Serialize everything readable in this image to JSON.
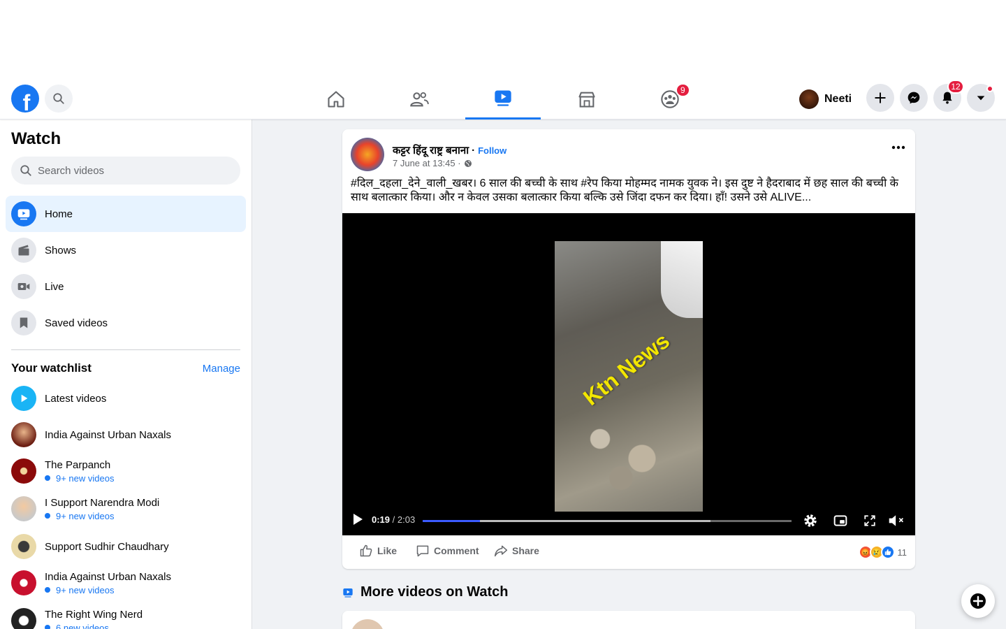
{
  "nav": {
    "groups_badge": "9",
    "profile_name": "Neeti",
    "notifications_badge": "12"
  },
  "sidebar": {
    "title": "Watch",
    "search_placeholder": "Search videos",
    "items": [
      {
        "label": "Home",
        "icon": "play-icon"
      },
      {
        "label": "Shows",
        "icon": "clapperboard-icon"
      },
      {
        "label": "Live",
        "icon": "live-camera-icon"
      },
      {
        "label": "Saved videos",
        "icon": "bookmark-icon"
      }
    ],
    "watchlist_title": "Your watchlist",
    "manage_label": "Manage",
    "watchlist": [
      {
        "name": "Latest videos",
        "sub": ""
      },
      {
        "name": "India Against Urban Naxals",
        "sub": ""
      },
      {
        "name": "The Parpanch",
        "sub": "9+ new videos"
      },
      {
        "name": "I Support Narendra Modi",
        "sub": "9+ new videos"
      },
      {
        "name": "Support Sudhir Chaudhary",
        "sub": ""
      },
      {
        "name": "India Against Urban Naxals",
        "sub": "9+ new videos"
      },
      {
        "name": "The Right Wing Nerd",
        "sub": "6 new videos"
      }
    ]
  },
  "post": {
    "author": "कट्टर हिंदू राष्ट्र बनाना",
    "separator": "·",
    "follow": "Follow",
    "timestamp": "7 June at 13:45 ·",
    "text": "#दिल_दहला_देने_वाली_खबर। 6 साल की बच्ची के साथ #रेप किया मोहम्मद नामक युवक ने। इस दुष्ट ने हैदराबाद में छह साल की बच्ची के साथ बलात्कार किया। और न केवल उसका बलात्कार किया बल्कि उसे जिंदा दफन कर दिया। हाँ! उसने उसे ALIVE...",
    "video": {
      "watermark": "Ktn News",
      "current_time": "0:19",
      "duration": "/ 2:03",
      "progress": 0.155,
      "buffered": 0.78
    },
    "actions": {
      "like": "Like",
      "comment": "Comment",
      "share": "Share"
    },
    "reaction_count": "11"
  },
  "more_videos_title": "More videos on Watch",
  "colors": {
    "brand": "#1877f2",
    "badge": "#e41e3f",
    "active_bg": "#e7f3ff"
  }
}
